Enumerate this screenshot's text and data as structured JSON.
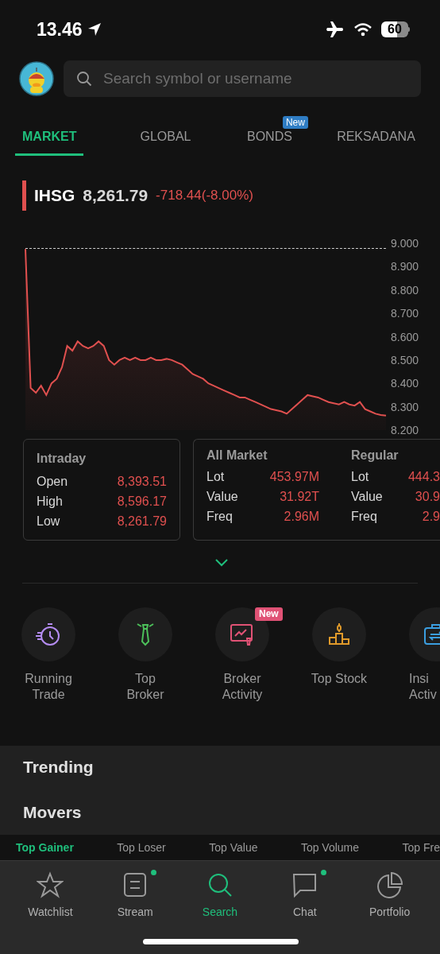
{
  "status_bar": {
    "time": "13.46",
    "battery": "60"
  },
  "search": {
    "placeholder": "Search symbol or username"
  },
  "tabs": [
    {
      "label": "MARKET",
      "selected": true
    },
    {
      "label": "GLOBAL",
      "selected": false
    },
    {
      "label": "BONDS",
      "selected": false,
      "badge": "New"
    },
    {
      "label": "REKSADANA",
      "selected": false
    }
  ],
  "index": {
    "name": "IHSG",
    "value": "8,261.79",
    "change": "-718.44(-8.00%)"
  },
  "chart": {
    "chart_data": {
      "type": "area",
      "ylim": [
        8.2,
        9.0
      ],
      "yticks": [
        {
          "value": 9.0,
          "label": "9.000"
        },
        {
          "value": 8.9,
          "label": "8.900"
        },
        {
          "value": 8.8,
          "label": "8.800"
        },
        {
          "value": 8.7,
          "label": "8.700"
        },
        {
          "value": 8.6,
          "label": "8.600"
        },
        {
          "value": 8.5,
          "label": "8.500"
        },
        {
          "value": 8.4,
          "label": "8.400"
        },
        {
          "value": 8.3,
          "label": "8.300"
        },
        {
          "value": 8.2,
          "label": "8.200"
        }
      ],
      "series": [
        {
          "color": "#e0504f",
          "values": [
            8.975,
            8.38,
            8.36,
            8.39,
            8.35,
            8.4,
            8.42,
            8.47,
            8.56,
            8.54,
            8.58,
            8.56,
            8.55,
            8.56,
            8.58,
            8.56,
            8.5,
            8.48,
            8.5,
            8.51,
            8.5,
            8.51,
            8.5,
            8.5,
            8.51,
            8.5,
            8.5,
            8.505,
            8.5,
            8.49,
            8.48,
            8.46,
            8.44,
            8.43,
            8.42,
            8.4,
            8.39,
            8.38,
            8.37,
            8.36,
            8.35,
            8.34,
            8.34,
            8.33,
            8.32,
            8.31,
            8.3,
            8.29,
            8.285,
            8.28,
            8.27,
            8.29,
            8.31,
            8.33,
            8.35,
            8.345,
            8.34,
            8.33,
            8.32,
            8.315,
            8.31,
            8.32,
            8.31,
            8.305,
            8.32,
            8.29,
            8.28,
            8.27,
            8.265,
            8.262
          ]
        }
      ]
    }
  },
  "intraday": {
    "title": "Intraday",
    "rows": [
      {
        "label": "Open",
        "value": "8,393.51"
      },
      {
        "label": "High",
        "value": "8,596.17"
      },
      {
        "label": "Low",
        "value": "8,261.79"
      }
    ]
  },
  "market_stats": [
    {
      "title": "All Market",
      "rows": [
        {
          "label": "Lot",
          "value": "453.97M"
        },
        {
          "label": "Value",
          "value": "31.92T"
        },
        {
          "label": "Freq",
          "value": "2.96M"
        }
      ]
    },
    {
      "title": "Regular",
      "rows": [
        {
          "label": "Lot",
          "value": "444.3"
        },
        {
          "label": "Value",
          "value": "30.9"
        },
        {
          "label": "Freq",
          "value": "2.9"
        }
      ]
    }
  ],
  "shortcuts": [
    {
      "label": "Running Trade",
      "kind": "stopwatch"
    },
    {
      "label": "Top Broker",
      "kind": "tie"
    },
    {
      "label": "Broker Activity",
      "kind": "board",
      "badge": "New"
    },
    {
      "label": "Top Stock",
      "kind": "podium"
    },
    {
      "label": "Insi Activ",
      "kind": "briefcase"
    }
  ],
  "sections": [
    "Trending",
    "Movers"
  ],
  "movers_tabs": [
    {
      "label": "Top Gainer",
      "selected": true
    },
    {
      "label": "Top Loser",
      "selected": false
    },
    {
      "label": "Top Value",
      "selected": false
    },
    {
      "label": "Top Volume",
      "selected": false
    },
    {
      "label": "Top Fre",
      "selected": false
    }
  ],
  "nav": [
    {
      "label": "Watchlist",
      "kind": "star",
      "selected": false,
      "dot": false
    },
    {
      "label": "Stream",
      "kind": "stream",
      "selected": false,
      "dot": true
    },
    {
      "label": "Search",
      "kind": "search",
      "selected": true,
      "dot": false
    },
    {
      "label": "Chat",
      "kind": "chat",
      "selected": false,
      "dot": true
    },
    {
      "label": "Portfolio",
      "kind": "pie",
      "selected": false,
      "dot": false
    }
  ]
}
